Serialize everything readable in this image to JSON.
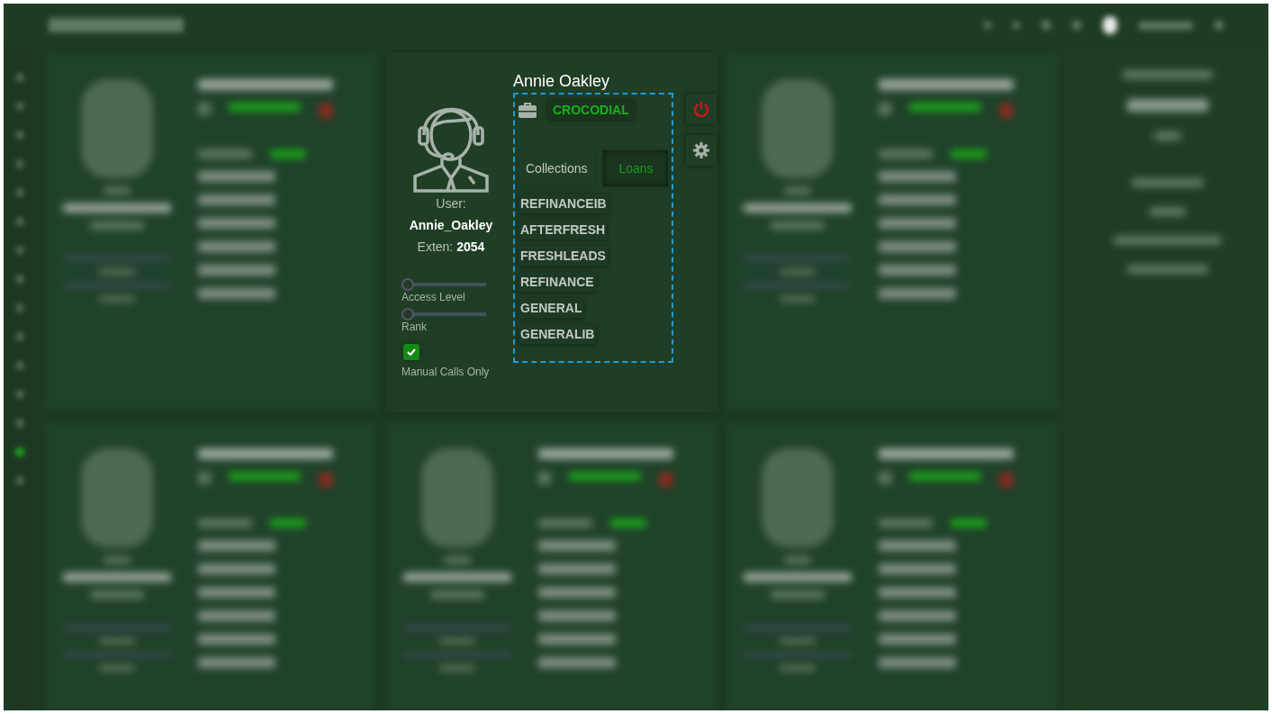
{
  "user_card": {
    "full_name": "Annie Oakley",
    "company": "CROCODIAL",
    "user_label": "User:",
    "username": "Annie_Oakley",
    "extension_label": "Exten:",
    "extension": "2054",
    "tabs": [
      {
        "label": "Collections",
        "selected": false
      },
      {
        "label": "Loans",
        "selected": true
      }
    ],
    "campaigns": [
      "REFINANCEIB",
      "AFTERFRESH",
      "FRESHLEADS",
      "REFINANCE",
      "GENERAL",
      "GENERALIB"
    ],
    "sliders": [
      {
        "label": "Access Level",
        "level": 0
      },
      {
        "label": "Rank",
        "level": 0
      }
    ],
    "manual_calls": {
      "label": "Manual Calls Only",
      "checked": true
    }
  }
}
